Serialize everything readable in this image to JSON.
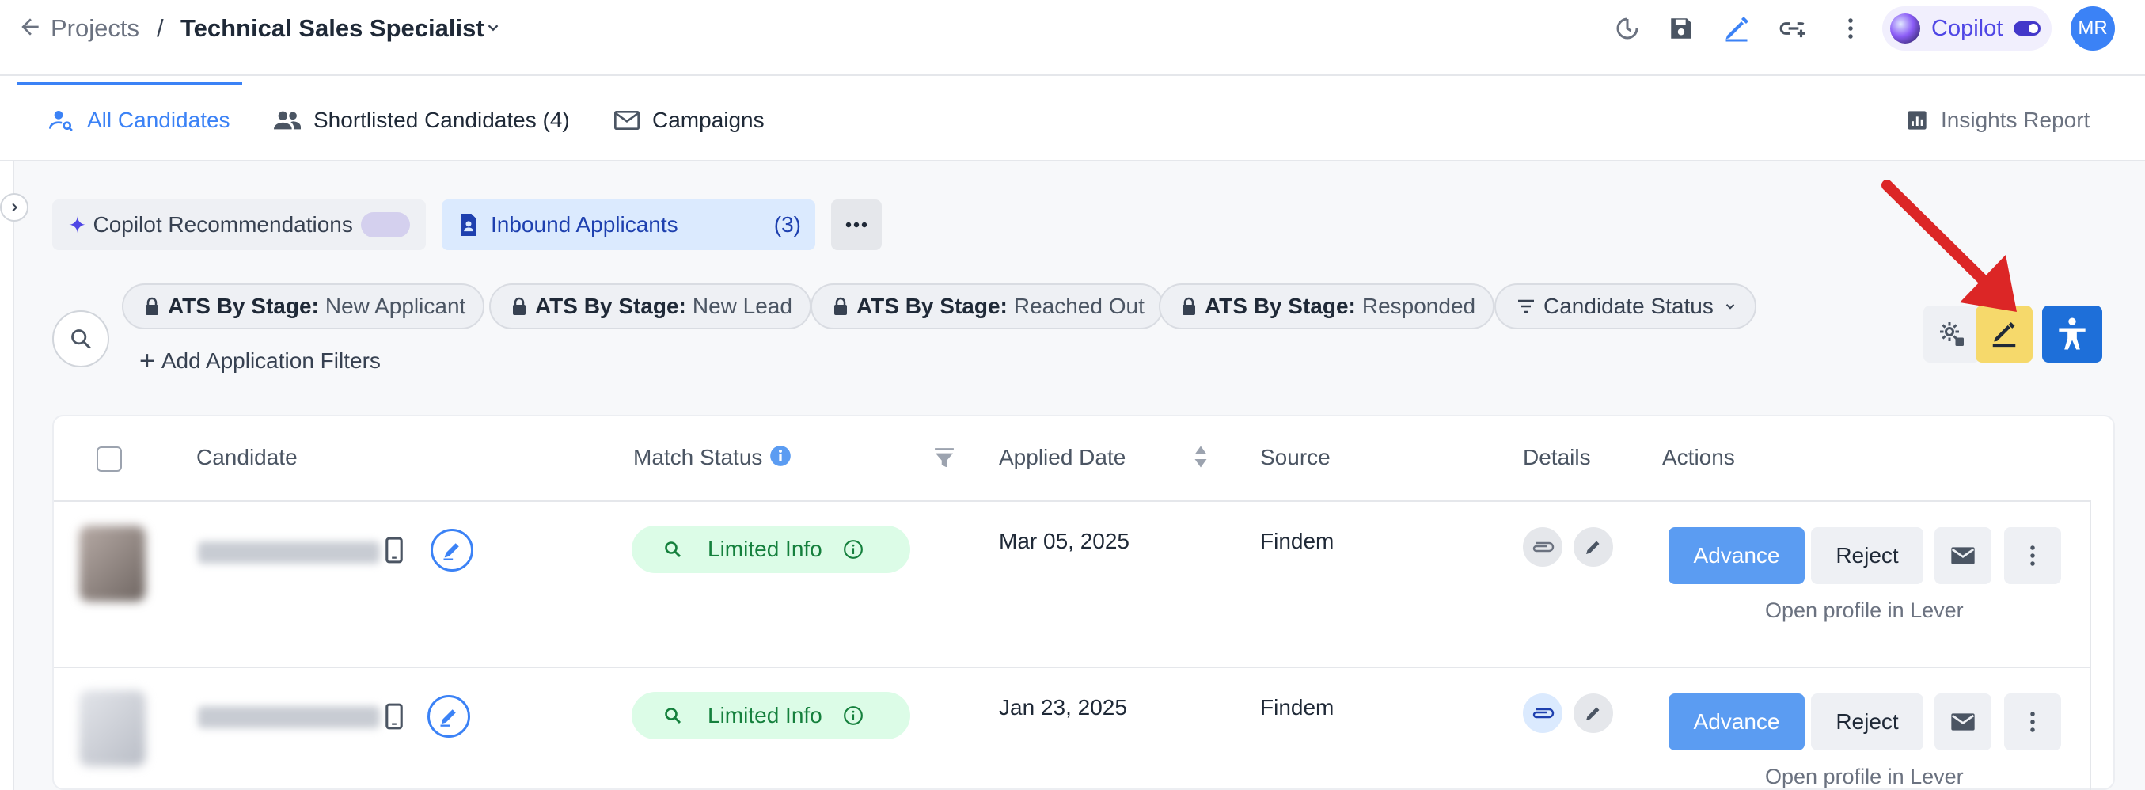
{
  "header": {
    "breadcrumb_root": "Projects",
    "separator": "/",
    "project_title": "Technical Sales Specialist",
    "copilot_label": "Copilot",
    "avatar_initials": "MR"
  },
  "tabs": [
    {
      "label": "All Candidates",
      "active": true
    },
    {
      "label": "Shortlisted Candidates (4)",
      "active": false
    },
    {
      "label": "Campaigns",
      "active": false
    }
  ],
  "insights_label": "Insights Report",
  "views": {
    "copilot_recommendations": "Copilot Recommendations",
    "inbound_label": "Inbound Applicants",
    "inbound_count": "(3)"
  },
  "filters": [
    {
      "key": "ATS By Stage:",
      "value": "New Applicant"
    },
    {
      "key": "ATS By Stage:",
      "value": "New Lead"
    },
    {
      "key": "ATS By Stage:",
      "value": "Reached Out"
    },
    {
      "key": "ATS By Stage:",
      "value": "Responded"
    }
  ],
  "candidate_status_filter": "Candidate Status",
  "add_filters_label": "Add Application Filters",
  "table": {
    "columns": {
      "candidate": "Candidate",
      "match_status": "Match Status",
      "applied_date": "Applied Date",
      "source": "Source",
      "details": "Details",
      "actions": "Actions"
    },
    "rows": [
      {
        "match_status": "Limited Info",
        "applied_date": "Mar 05, 2025",
        "source": "Findem",
        "advance": "Advance",
        "reject": "Reject",
        "lever_link": "Open profile in Lever"
      },
      {
        "match_status": "Limited Info",
        "applied_date": "Jan 23, 2025",
        "source": "Findem",
        "advance": "Advance",
        "reject": "Reject",
        "lever_link": "Open profile in Lever"
      }
    ]
  },
  "colors": {
    "accent": "#3b82f6",
    "highlight_button": "#f6d96b",
    "arrow": "#dc2626",
    "match_green": "#15803d"
  },
  "icons": [
    "back-arrow-icon",
    "chevron-down-icon",
    "history-icon",
    "save-icon",
    "pen-icon",
    "link-add-icon",
    "more-vertical-icon",
    "search-icon",
    "lock-icon",
    "filter-icon",
    "gear-icon",
    "accessibility-icon",
    "paperclip-icon",
    "mail-icon",
    "info-icon",
    "phone-icon",
    "chart-icon",
    "users-icon",
    "user-search-icon",
    "contact-card-icon",
    "sparkle-icon",
    "sort-icon"
  ]
}
